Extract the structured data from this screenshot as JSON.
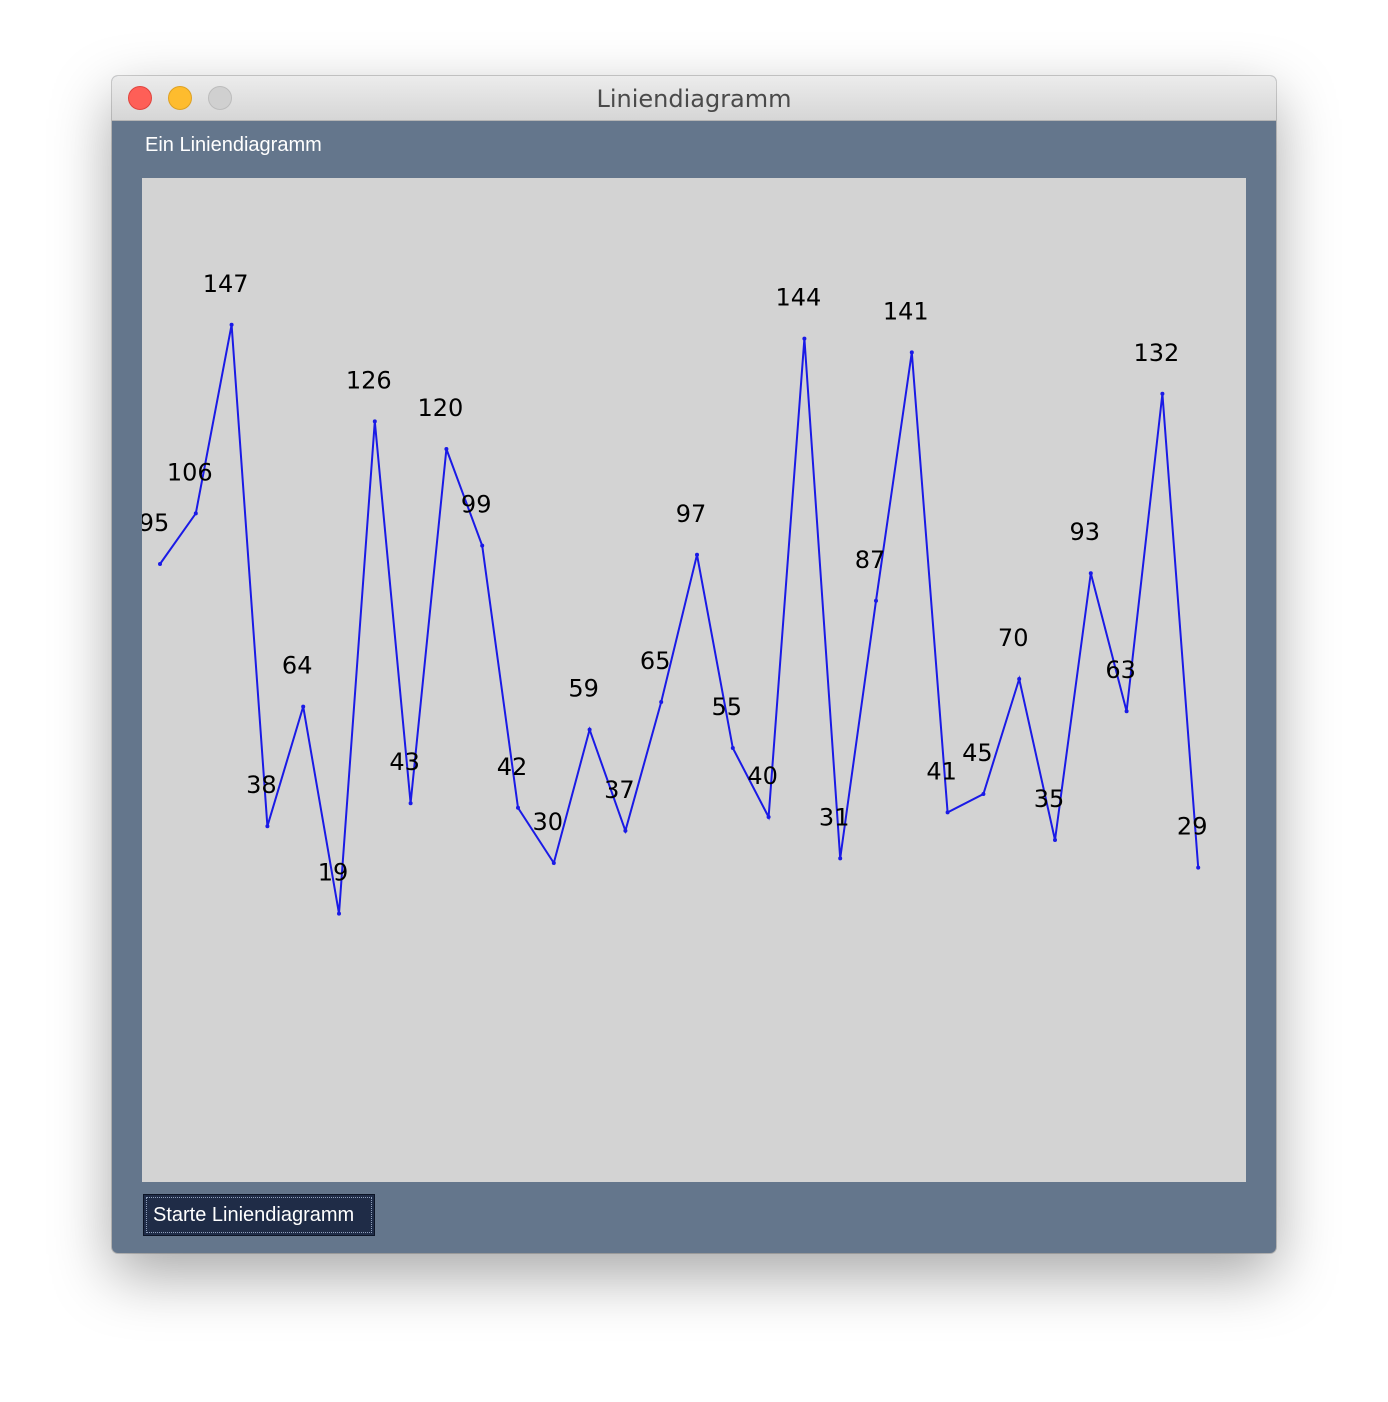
{
  "window": {
    "title": "Liniendiagramm"
  },
  "panel": {
    "label": "Ein Liniendiagramm"
  },
  "controls": {
    "start_button_label": "Starte Liniendiagramm"
  },
  "colors": {
    "window_background": "#64768c",
    "chart_background": "#d3d3d3",
    "line": "#1a1ae6",
    "button_background": "#1f2c47"
  },
  "chart_data": {
    "type": "line",
    "title": "",
    "xlabel": "",
    "ylabel": "",
    "grid": false,
    "ylim": [
      0,
      200
    ],
    "values": [
      95,
      106,
      147,
      38,
      64,
      19,
      126,
      43,
      120,
      99,
      42,
      30,
      59,
      37,
      65,
      97,
      55,
      40,
      144,
      31,
      87,
      141,
      41,
      45,
      70,
      35,
      93,
      63,
      132,
      29
    ],
    "data_labels": [
      "95",
      "106",
      "147",
      "38",
      "64",
      "19",
      "126",
      "43",
      "120",
      "99",
      "42",
      "30",
      "59",
      "37",
      "65",
      "97",
      "55",
      "40",
      "144",
      "31",
      "87",
      "141",
      "41",
      "45",
      "70",
      "35",
      "93",
      "63",
      "132",
      "29"
    ]
  }
}
